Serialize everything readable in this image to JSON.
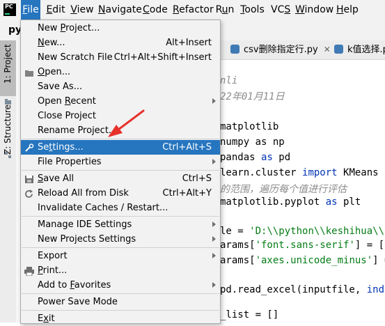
{
  "menubar": {
    "items": [
      {
        "label": "File",
        "u": "F",
        "rest": "ile"
      },
      {
        "label": "Edit",
        "u": "E",
        "rest": "dit"
      },
      {
        "label": "View",
        "u": "V",
        "rest": "iew"
      },
      {
        "label": "Navigate",
        "u": "N",
        "rest": "avigate"
      },
      {
        "label": "Code",
        "u": "C",
        "rest": "ode"
      },
      {
        "label": "Refactor",
        "u": "R",
        "rest": "efactor"
      },
      {
        "label": "Run",
        "pre": "R",
        "u": "u",
        "rest": "n"
      },
      {
        "label": "Tools",
        "u": "T",
        "rest": "ools"
      },
      {
        "label": "VCS",
        "pre": "VC",
        "u": "S",
        "rest": ""
      },
      {
        "label": "Window",
        "u": "W",
        "rest": "indow"
      },
      {
        "label": "Help",
        "u": "H",
        "rest": "elp"
      }
    ]
  },
  "project_strip": {
    "name": "py"
  },
  "sidebar": {
    "project_tab": "1: Project",
    "structure_tab": "Z: Structure"
  },
  "tabs": [
    {
      "label": "csv删除指定行.py"
    },
    {
      "label": "k值选择.py"
    }
  ],
  "editor": {
    "lines": [
      [
        {
          "t": "nli",
          "c": "c-comment"
        }
      ],
      [
        {
          "t": "22年01月11日",
          "c": "c-comment"
        }
      ],
      [
        {
          "t": "",
          "c": ""
        }
      ],
      [
        {
          "t": "matplotlib",
          "c": ""
        }
      ],
      [
        {
          "t": "numpy as np",
          "c": ""
        }
      ],
      [
        {
          "t": "pandas ",
          "c": ""
        },
        {
          "t": "as",
          "c": "c-kw"
        },
        {
          "t": " pd",
          "c": ""
        }
      ],
      [
        {
          "t": "learn.cluster ",
          "c": ""
        },
        {
          "t": "import",
          "c": "c-kw"
        },
        {
          "t": " KMeans",
          "c": ""
        }
      ],
      [
        {
          "t": "的范围，遍历每个值进行评估",
          "c": "c-comment"
        }
      ],
      [
        {
          "t": "matplotlib.pyplot ",
          "c": ""
        },
        {
          "t": "as",
          "c": "c-kw"
        },
        {
          "t": " plt",
          "c": ""
        }
      ],
      [
        {
          "t": "",
          "c": ""
        }
      ],
      [
        {
          "t": "le = ",
          "c": ""
        },
        {
          "t": "'D:\\\\python\\\\keshihua\\\\yu",
          "c": "c-str"
        }
      ],
      [
        {
          "t": "arams[",
          "c": ""
        },
        {
          "t": "'font.sans-serif'",
          "c": "c-str"
        },
        {
          "t": "] = [",
          "c": ""
        },
        {
          "t": "'S",
          "c": "c-str"
        }
      ],
      [
        {
          "t": "arams[",
          "c": ""
        },
        {
          "t": "'axes.unicode_minus'",
          "c": "c-str"
        },
        {
          "t": "] = ",
          "c": ""
        }
      ],
      [
        {
          "t": "",
          "c": ""
        }
      ],
      [
        {
          "t": "pd.read_excel(inputfile, ",
          "c": ""
        },
        {
          "t": "index",
          "c": "c-kw"
        }
      ],
      [
        {
          "t": "",
          "c": ""
        }
      ],
      [
        {
          "t": "_list = []",
          "c": ""
        }
      ]
    ]
  },
  "file_menu": {
    "items": [
      {
        "type": "item",
        "pre": "New ",
        "u": "P",
        "rest": "roject...",
        "shortcut": "",
        "submenu": false,
        "icon": ""
      },
      {
        "type": "item",
        "pre": "",
        "u": "N",
        "rest": "ew...",
        "shortcut": "Alt+Insert",
        "submenu": false,
        "icon": ""
      },
      {
        "type": "item",
        "pre": "New Scratch File",
        "u": "",
        "rest": "",
        "shortcut": "Ctrl+Alt+Shift+Insert",
        "submenu": false,
        "icon": ""
      },
      {
        "type": "item",
        "pre": "",
        "u": "O",
        "rest": "pen...",
        "shortcut": "",
        "submenu": false,
        "icon": "folder-icon"
      },
      {
        "type": "item",
        "pre": "Save As...",
        "u": "",
        "rest": "",
        "shortcut": "",
        "submenu": false,
        "icon": ""
      },
      {
        "type": "item",
        "pre": "Open ",
        "u": "R",
        "rest": "ecent",
        "shortcut": "",
        "submenu": true,
        "icon": ""
      },
      {
        "type": "item",
        "pre": "Close Project",
        "u": "",
        "rest": "",
        "shortcut": "",
        "submenu": false,
        "icon": ""
      },
      {
        "type": "item",
        "pre": "Rename Project...",
        "u": "",
        "rest": "",
        "shortcut": "",
        "submenu": false,
        "icon": ""
      },
      {
        "type": "sep"
      },
      {
        "type": "item",
        "pre": "Se",
        "u": "t",
        "rest": "tings...",
        "shortcut": "Ctrl+Alt+S",
        "submenu": false,
        "icon": "wrench-icon",
        "selected": true
      },
      {
        "type": "item",
        "pre": "File Properties",
        "u": "",
        "rest": "",
        "shortcut": "",
        "submenu": true,
        "icon": ""
      },
      {
        "type": "sep"
      },
      {
        "type": "item",
        "pre": "",
        "u": "S",
        "rest": "ave All",
        "shortcut": "Ctrl+S",
        "submenu": false,
        "icon": "save-icon"
      },
      {
        "type": "item",
        "pre": "Reload All from Disk",
        "u": "",
        "rest": "",
        "shortcut": "Ctrl+Alt+Y",
        "submenu": false,
        "icon": "reload-icon"
      },
      {
        "type": "item",
        "pre": "Invalidate Caches / Restart...",
        "u": "",
        "rest": "",
        "shortcut": "",
        "submenu": false,
        "icon": ""
      },
      {
        "type": "sep"
      },
      {
        "type": "item",
        "pre": "Manage IDE Settings",
        "u": "",
        "rest": "",
        "shortcut": "",
        "submenu": true,
        "icon": ""
      },
      {
        "type": "item",
        "pre": "New Projects Settings",
        "u": "",
        "rest": "",
        "shortcut": "",
        "submenu": true,
        "icon": ""
      },
      {
        "type": "sep"
      },
      {
        "type": "item",
        "pre": "Export",
        "u": "",
        "rest": "",
        "shortcut": "",
        "submenu": true,
        "icon": ""
      },
      {
        "type": "item",
        "pre": "",
        "u": "P",
        "rest": "rint...",
        "shortcut": "",
        "submenu": false,
        "icon": "printer-icon"
      },
      {
        "type": "item",
        "pre": "Add to ",
        "u": "F",
        "rest": "avorites",
        "shortcut": "",
        "submenu": true,
        "icon": ""
      },
      {
        "type": "sep"
      },
      {
        "type": "item",
        "pre": "Power Save Mode",
        "u": "",
        "rest": "",
        "shortcut": "",
        "submenu": false,
        "icon": ""
      },
      {
        "type": "sep"
      },
      {
        "type": "item",
        "pre": "E",
        "u": "x",
        "rest": "it",
        "shortcut": "",
        "submenu": false,
        "icon": ""
      }
    ]
  },
  "colors": {
    "selection": "#2675bf",
    "annotation_arrow": "#e8322c",
    "comment": "#8c8c8c",
    "keyword": "#0033b3",
    "string": "#067d17"
  }
}
